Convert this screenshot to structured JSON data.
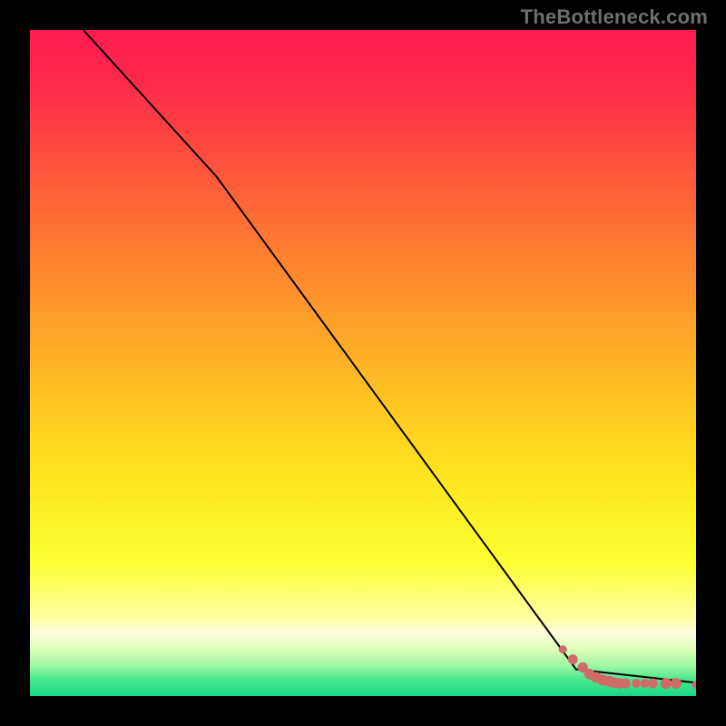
{
  "watermark": "TheBottleneck.com",
  "colors": {
    "frame": "#000000",
    "line": "#000000",
    "point_fill": "#cf6a67",
    "point_stroke": "#cf6a67",
    "gradient_stops": [
      {
        "offset": 0.0,
        "color": "#ff1a52"
      },
      {
        "offset": 0.08,
        "color": "#ff2a4a"
      },
      {
        "offset": 0.18,
        "color": "#ff4b3f"
      },
      {
        "offset": 0.3,
        "color": "#ff7333"
      },
      {
        "offset": 0.42,
        "color": "#ff9a2a"
      },
      {
        "offset": 0.55,
        "color": "#ffc222"
      },
      {
        "offset": 0.68,
        "color": "#ffe81e"
      },
      {
        "offset": 0.8,
        "color": "#fcff32"
      },
      {
        "offset": 0.885,
        "color": "#ffffa8"
      },
      {
        "offset": 0.905,
        "color": "#fdffde"
      },
      {
        "offset": 0.93,
        "color": "#dcffb8"
      },
      {
        "offset": 0.955,
        "color": "#9cf7a4"
      },
      {
        "offset": 0.975,
        "color": "#4ae88e"
      },
      {
        "offset": 1.0,
        "color": "#18d885"
      }
    ]
  },
  "chart_data": {
    "type": "line",
    "title": "",
    "xlabel": "",
    "ylabel": "",
    "xlim": [
      0,
      100
    ],
    "ylim": [
      0,
      100
    ],
    "grid": false,
    "series": [
      {
        "name": "bottleneck-curve",
        "x": [
          8,
          28,
          82,
          100
        ],
        "y": [
          100,
          78,
          4,
          2
        ]
      }
    ],
    "points": {
      "name": "highlighted-points",
      "x": [
        80,
        81.5,
        83,
        84,
        85,
        86,
        87,
        87.8,
        88.6,
        89.4,
        91,
        92.3,
        93.5,
        95.5,
        97,
        100
      ],
      "y": [
        7.0,
        5.5,
        4.3,
        3.3,
        2.8,
        2.4,
        2.2,
        2.0,
        1.9,
        1.9,
        1.9,
        1.9,
        1.9,
        1.9,
        1.9,
        1.7
      ],
      "r": [
        4.0,
        5.0,
        5.2,
        5.4,
        5.6,
        5.6,
        5.6,
        5.4,
        5.2,
        5.0,
        4.5,
        4.5,
        5.0,
        5.6,
        5.4,
        4.0
      ]
    }
  }
}
